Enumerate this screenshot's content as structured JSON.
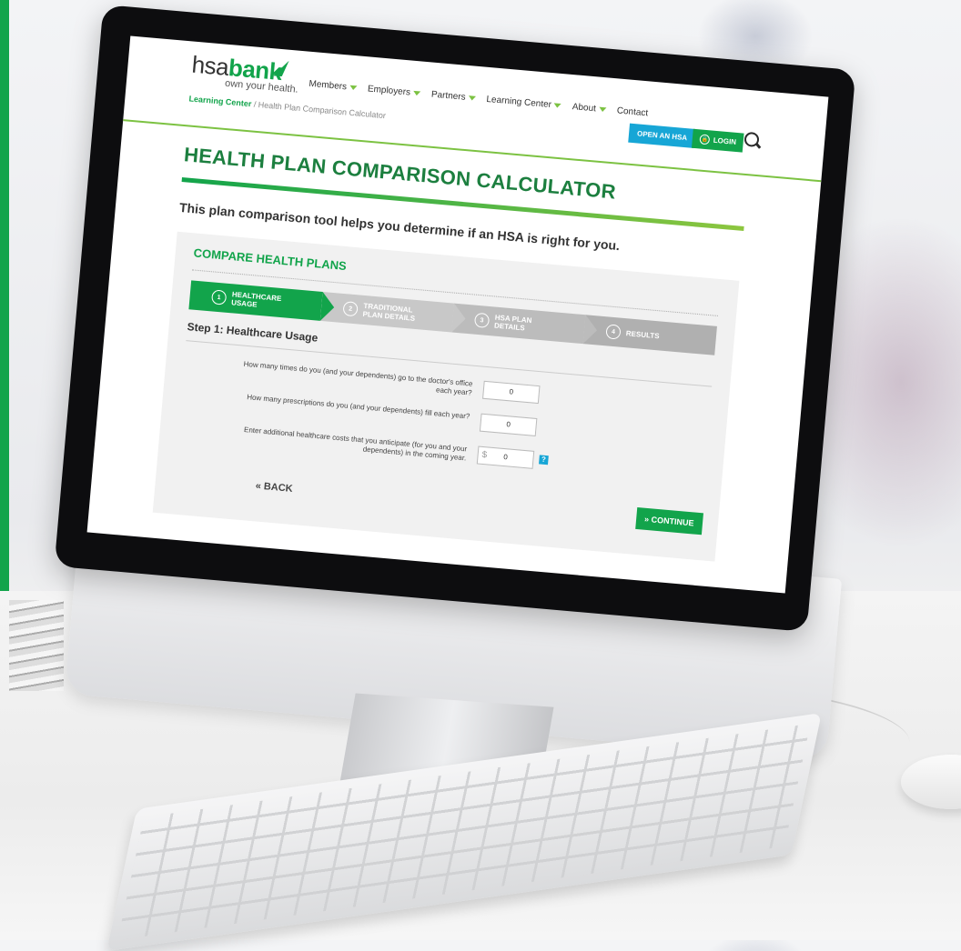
{
  "brand": {
    "logo_prefix": "hsa",
    "logo_suffix": "bank",
    "tagline": "own your health."
  },
  "nav": {
    "items": [
      "Members",
      "Employers",
      "Partners",
      "Learning Center",
      "About",
      "Contact"
    ]
  },
  "breadcrumb": {
    "link": "Learning Center",
    "current": " / Health Plan Comparison Calculator"
  },
  "header_buttons": {
    "open": "OPEN AN HSA",
    "login": "LOGIN"
  },
  "page": {
    "title": "HEALTH PLAN COMPARISON CALCULATOR",
    "subtitle": "This plan comparison tool helps you determine if an HSA is right for you.",
    "section_title": "COMPARE HEALTH PLANS",
    "step_heading": "Step 1: Healthcare Usage"
  },
  "steps": [
    {
      "num": "1",
      "label": "HEALTHCARE\nUSAGE",
      "active": true
    },
    {
      "num": "2",
      "label": "TRADITIONAL\nPLAN DETAILS",
      "active": false
    },
    {
      "num": "3",
      "label": "HSA PLAN\nDETAILS",
      "active": false
    },
    {
      "num": "4",
      "label": "RESULTS",
      "active": false
    }
  ],
  "form": {
    "q1": {
      "label": "How many times do you (and your dependents) go to the doctor's office each year?",
      "value": "0"
    },
    "q2": {
      "label": "How many prescriptions do you (and your dependents) fill each year?",
      "value": "0"
    },
    "q3": {
      "label": "Enter additional healthcare costs that you anticipate (for you and your dependents) in the coming year.",
      "prefix": "$",
      "value": "0",
      "help": "?"
    },
    "back": "« BACK",
    "continue": "» CONTINUE"
  },
  "colors": {
    "brand_green": "#12a44b",
    "accent_blue": "#17a6d6",
    "lime": "#7cc242"
  }
}
